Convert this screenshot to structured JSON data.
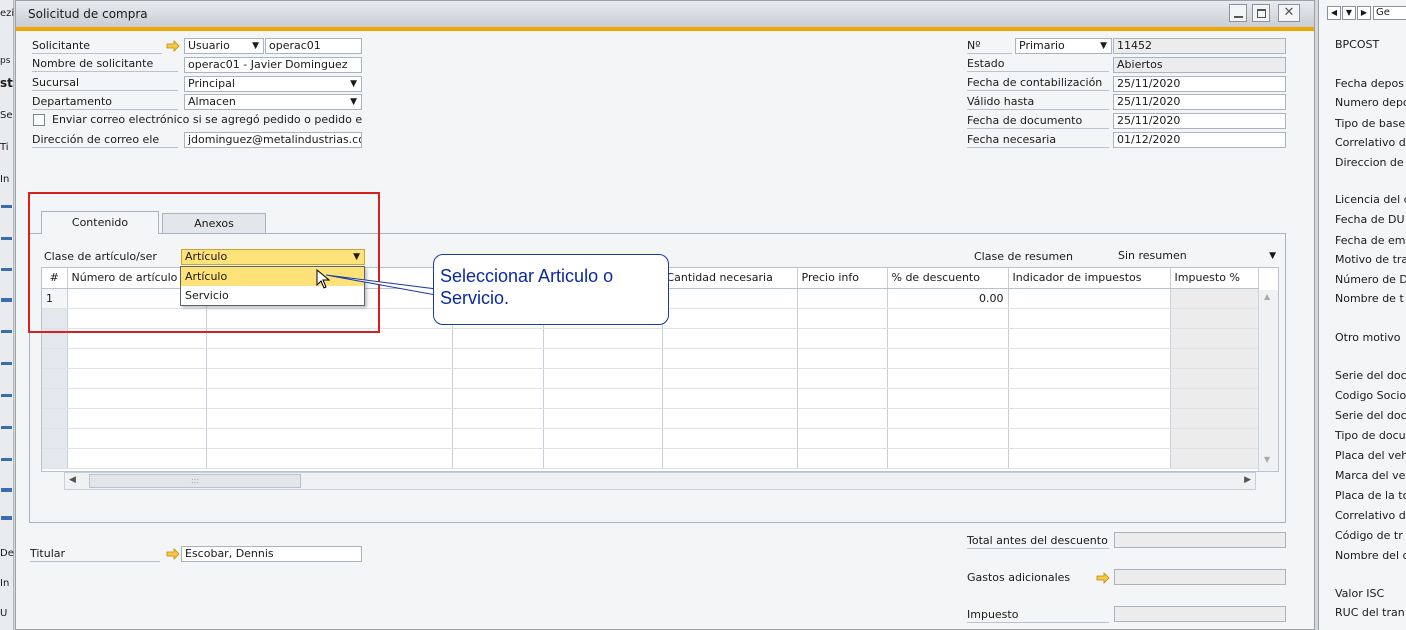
{
  "window": {
    "title": "Solicitud de compra"
  },
  "left_strip": {
    "items": [
      "ezi",
      "ps",
      "st",
      "Se",
      "Ti",
      "In",
      "De",
      "In",
      "U"
    ]
  },
  "header_left": {
    "solicitante_label": "Solicitante",
    "solicitante_type": "Usuario",
    "solicitante_code": "operac01",
    "nombre_label": "Nombre de solicitante",
    "nombre_value": "operac01 - Javier Dominguez",
    "sucursal_label": "Sucursal",
    "sucursal_value": "Principal",
    "departamento_label": "Departamento",
    "departamento_value": "Almacen",
    "email_check_label": "Enviar correo electrónico si se agregó pedido o pedido e",
    "direccion_label": "Dirección de correo ele",
    "direccion_value": "jdominguez@metalindustrias.co"
  },
  "header_right": {
    "num_label": "Nº",
    "num_series": "Primario",
    "num_value": "11452",
    "estado_label": "Estado",
    "estado_value": "Abiertos",
    "fecha_cont_label": "Fecha de contabilización",
    "fecha_cont_value": "25/11/2020",
    "valido_label": "Válido hasta",
    "valido_value": "25/11/2020",
    "fecha_doc_label": "Fecha de documento",
    "fecha_doc_value": "25/11/2020",
    "fecha_nec_label": "Fecha necesaria",
    "fecha_nec_value": "01/12/2020"
  },
  "tabs": [
    {
      "label": "Contenido"
    },
    {
      "label": "Anexos"
    }
  ],
  "item_class": {
    "label": "Clase de artículo/ser",
    "value": "Artículo",
    "options": [
      "Artículo",
      "Servicio"
    ]
  },
  "summary": {
    "label": "Clase de resumen",
    "value": "Sin resumen"
  },
  "grid": {
    "columns": [
      "#",
      "Número de artículo",
      "",
      "",
      "",
      "Cantidad necesaria",
      "Precio info",
      "% de descuento",
      "Indicador de impuestos",
      "Impuesto %"
    ],
    "rows": [
      {
        "num": "1",
        "discount": "0.00"
      }
    ]
  },
  "callout": {
    "text": "Seleccionar Articulo o Servicio."
  },
  "footer": {
    "titular_label": "Titular",
    "titular_value": "Escobar, Dennis",
    "total_label": "Total antes del descuento",
    "gastos_label": "Gastos adicionales",
    "impuesto_label": "Impuesto"
  },
  "right_panel": {
    "title": "BPCOST",
    "nav_text": "Ge",
    "labels": [
      "Fecha depos",
      "Numero depo",
      "Tipo de base",
      "Correlativo d",
      "Direccion de",
      "Licencia del c",
      "Fecha de DU",
      "Fecha de em",
      "Motivo de tra",
      "Número de D",
      "Nombre de t",
      "Otro motivo",
      "Serie del doc",
      "Codigo Socio",
      "Serie del doc",
      "Tipo de docu",
      "Placa del veh",
      "Marca del ve",
      "Placa de la to",
      "Correlativo d",
      "Código de tr",
      "Nombre del c",
      "Valor ISC",
      "RUC del tran"
    ]
  },
  "colors": {
    "accent": "#f0a500",
    "title_bar": "#d4d8de",
    "highlight_box": "#d92020",
    "callout_border": "#1a3aa8",
    "dropdown_hl": "#fde27a"
  }
}
